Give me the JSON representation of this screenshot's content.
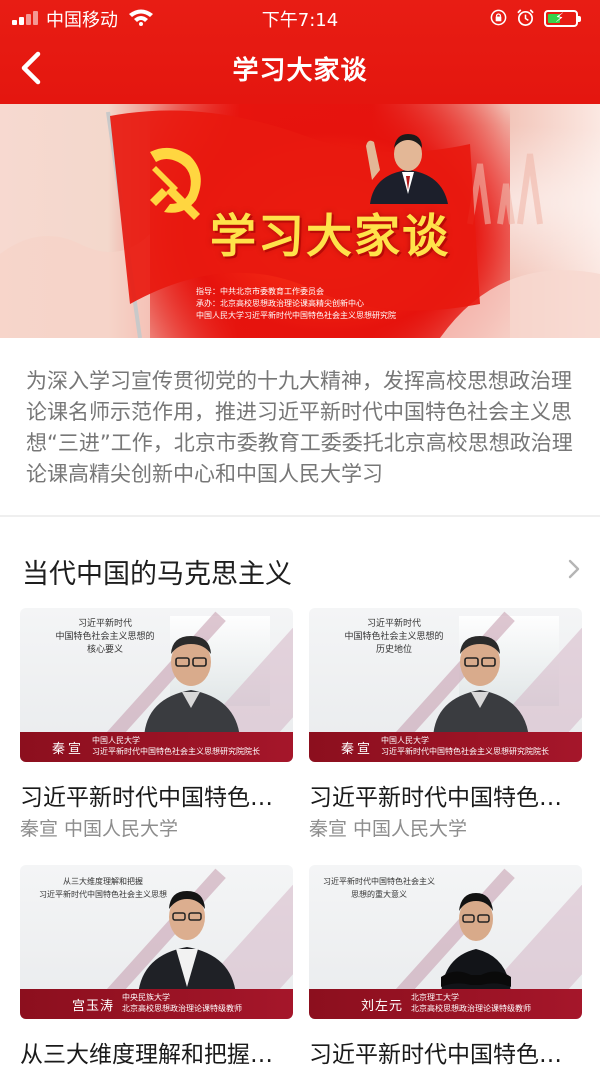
{
  "status_bar": {
    "carrier": "中国移动",
    "time": "下午7:14",
    "battery_fraction": 0.4
  },
  "navbar": {
    "title": "学习大家谈",
    "back_icon": "chevron-left-icon"
  },
  "banner": {
    "title": "学习大家谈",
    "credits": [
      "指导：中共北京市委教育工作委员会",
      "承办：北京高校思想政治理论课高精尖创新中心",
      "中国人民大学习近平新时代中国特色社会主义思想研究院"
    ]
  },
  "intro": {
    "text": "为深入学习宣传贯彻党的十九大精神，发挥高校思想政治理论课名师示范作用，推进习近平新时代中国特色社会主义思想“三进”工作，北京市委教育工委委托北京高校思想政治理论课高精尖创新中心和中国人民大学习"
  },
  "section": {
    "title": "当代中国的马克思主义",
    "more_icon": "chevron-right-icon",
    "videos": [
      {
        "thumb_title": "习近平新时代\n中国特色社会主义思想的\n核心要义",
        "speaker": "秦宣",
        "speaker_org": "中国人民大学\n习近平新时代中国特色社会主义思想研究院院长",
        "title": "习近平新时代中国特色社会主义思想的核心要义",
        "subtitle": "秦宣  中国人民大学"
      },
      {
        "thumb_title": "习近平新时代\n中国特色社会主义思想的\n历史地位",
        "speaker": "秦宣",
        "speaker_org": "中国人民大学\n习近平新时代中国特色社会主义思想研究院院长",
        "title": "习近平新时代中国特色社会主义思想的历史地位",
        "subtitle": "秦宣  中国人民大学"
      },
      {
        "thumb_title": "从三大维度理解和把握\n习近平新时代中国特色社会主义思想",
        "speaker": "宫玉涛",
        "speaker_org": "中央民族大学\n北京高校思想政治理论课特级教师",
        "title": "从三大维度理解和把握习近平新时代中国特色社会主义思想"
      },
      {
        "thumb_title": "习近平新时代中国特色社会主义\n思想的重大意义",
        "speaker": "刘左元",
        "speaker_org": "北京理工大学\n北京高校思想政治理论课特级教师",
        "title": "习近平新时代中国特色社会主义思想的重大意义"
      }
    ]
  }
}
